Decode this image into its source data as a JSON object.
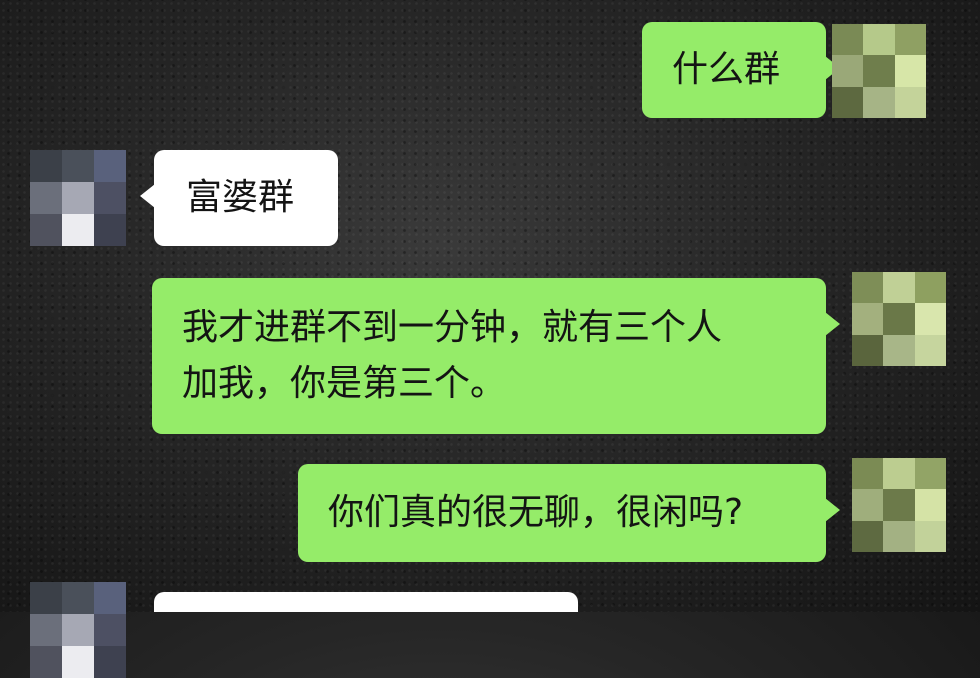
{
  "messages": [
    {
      "side": "right",
      "text": "什么群"
    },
    {
      "side": "left",
      "text": "富婆群"
    },
    {
      "side": "right",
      "text": "我才进群不到一分钟，就有三个人\n加我，你是第三个。"
    },
    {
      "side": "right",
      "text": "你们真的很无聊，很闲吗?"
    },
    {
      "side": "left",
      "text": ""
    }
  ],
  "colors": {
    "sent_bubble": "#95ec69",
    "received_bubble": "#ffffff",
    "text": "#141414"
  }
}
